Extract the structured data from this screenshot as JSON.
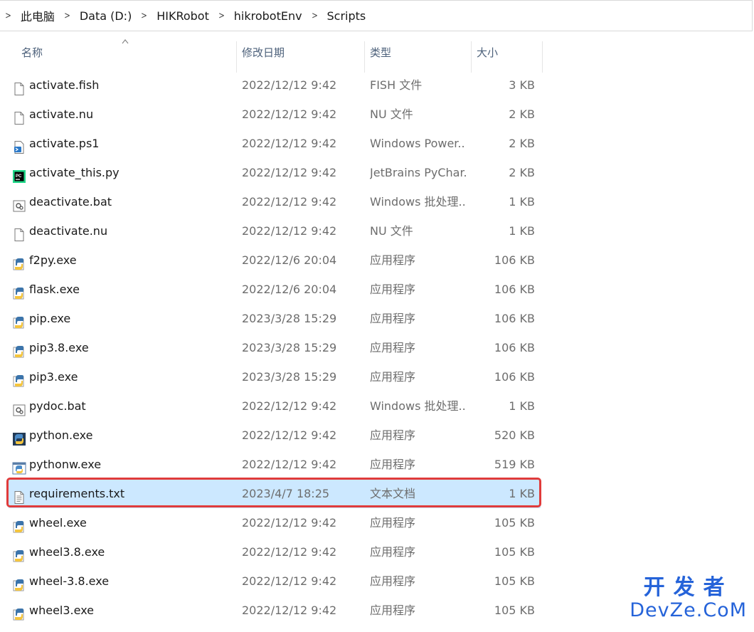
{
  "breadcrumb": {
    "segments": [
      "此电脑",
      "Data (D:)",
      "HIKRobot",
      "hikrobotEnv",
      "Scripts"
    ]
  },
  "columns": {
    "name": "名称",
    "modified": "修改日期",
    "type": "类型",
    "size": "大小"
  },
  "files": [
    {
      "name": "activate.fish",
      "modified": "2022/12/12 9:42",
      "type": "FISH 文件",
      "size": "3 KB",
      "icon": "file-icon"
    },
    {
      "name": "activate.nu",
      "modified": "2022/12/12 9:42",
      "type": "NU 文件",
      "size": "2 KB",
      "icon": "file-icon"
    },
    {
      "name": "activate.ps1",
      "modified": "2022/12/12 9:42",
      "type": "Windows Power...",
      "size": "2 KB",
      "icon": "powershell-script-icon"
    },
    {
      "name": "activate_this.py",
      "modified": "2022/12/12 9:42",
      "type": "JetBrains PyChar...",
      "size": "2 KB",
      "icon": "pycharm-icon"
    },
    {
      "name": "deactivate.bat",
      "modified": "2022/12/12 9:42",
      "type": "Windows 批处理...",
      "size": "1 KB",
      "icon": "batch-file-icon"
    },
    {
      "name": "deactivate.nu",
      "modified": "2022/12/12 9:42",
      "type": "NU 文件",
      "size": "1 KB",
      "icon": "file-icon"
    },
    {
      "name": "f2py.exe",
      "modified": "2022/12/6 20:04",
      "type": "应用程序",
      "size": "106 KB",
      "icon": "python-exe-icon"
    },
    {
      "name": "flask.exe",
      "modified": "2022/12/6 20:04",
      "type": "应用程序",
      "size": "106 KB",
      "icon": "python-exe-icon"
    },
    {
      "name": "pip.exe",
      "modified": "2023/3/28 15:29",
      "type": "应用程序",
      "size": "106 KB",
      "icon": "python-exe-icon"
    },
    {
      "name": "pip3.8.exe",
      "modified": "2023/3/28 15:29",
      "type": "应用程序",
      "size": "106 KB",
      "icon": "python-exe-icon"
    },
    {
      "name": "pip3.exe",
      "modified": "2023/3/28 15:29",
      "type": "应用程序",
      "size": "106 KB",
      "icon": "python-exe-icon"
    },
    {
      "name": "pydoc.bat",
      "modified": "2022/12/12 9:42",
      "type": "Windows 批处理...",
      "size": "1 KB",
      "icon": "batch-file-icon"
    },
    {
      "name": "python.exe",
      "modified": "2022/12/12 9:42",
      "type": "应用程序",
      "size": "520 KB",
      "icon": "python-app-icon"
    },
    {
      "name": "pythonw.exe",
      "modified": "2022/12/12 9:42",
      "type": "应用程序",
      "size": "519 KB",
      "icon": "pythonw-app-icon"
    },
    {
      "name": "requirements.txt",
      "modified": "2023/4/7 18:25",
      "type": "文本文档",
      "size": "1 KB",
      "icon": "text-file-icon",
      "selected": true
    },
    {
      "name": "wheel.exe",
      "modified": "2022/12/12 9:42",
      "type": "应用程序",
      "size": "105 KB",
      "icon": "python-exe-icon"
    },
    {
      "name": "wheel3.8.exe",
      "modified": "2022/12/12 9:42",
      "type": "应用程序",
      "size": "105 KB",
      "icon": "python-exe-icon"
    },
    {
      "name": "wheel-3.8.exe",
      "modified": "2022/12/12 9:42",
      "type": "应用程序",
      "size": "105 KB",
      "icon": "python-exe-icon"
    },
    {
      "name": "wheel3.exe",
      "modified": "2022/12/12 9:42",
      "type": "应用程序",
      "size": "105 KB",
      "icon": "python-exe-icon"
    }
  ],
  "watermark": {
    "line1": "开发者",
    "line2": "DevZe.CoM"
  },
  "colors": {
    "selection": "#cce8ff",
    "highlight_outline": "#e03b3b",
    "header_text": "#4c607a",
    "watermark": "#2563d9"
  }
}
